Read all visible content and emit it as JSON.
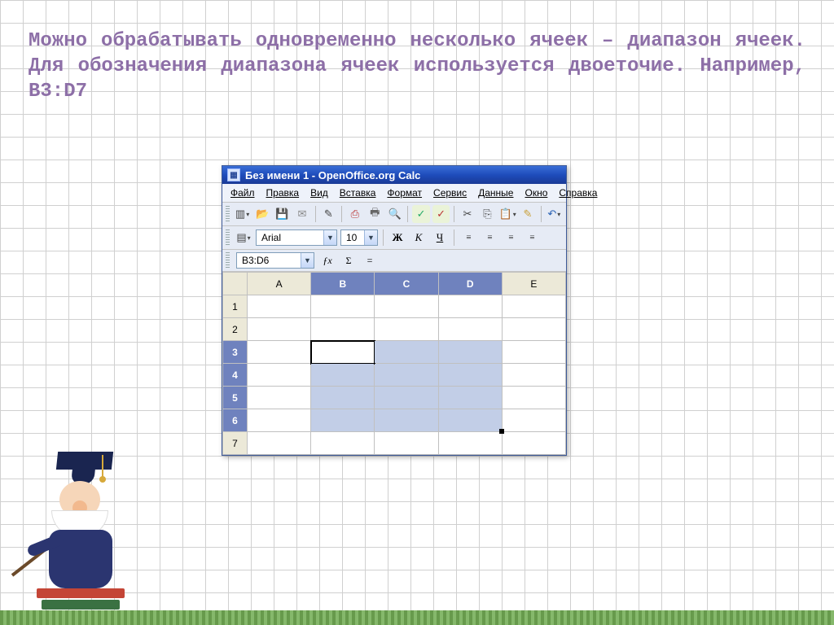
{
  "slide": {
    "text": "Можно обрабатывать одновременно несколько ячеек – диапазон ячеек. Для обозначения диапазона ячеек используется двоеточие. Например, B3:D7"
  },
  "window": {
    "title": "Без имени 1 - OpenOffice.org Calc"
  },
  "menu": {
    "file": "Файл",
    "edit": "Правка",
    "view": "Вид",
    "insert": "Вставка",
    "format": "Формат",
    "tools": "Сервис",
    "data": "Данные",
    "window": "Окно",
    "help": "Справка"
  },
  "format_bar": {
    "font": "Arial",
    "size": "10",
    "bold": "Ж",
    "italic": "К",
    "underline": "Ч"
  },
  "formula_bar": {
    "name_box": "B3:D6",
    "fx": "ƒx",
    "sigma": "Σ",
    "eq": "="
  },
  "columns": [
    "A",
    "B",
    "C",
    "D",
    "E"
  ],
  "rows": [
    "1",
    "2",
    "3",
    "4",
    "5",
    "6",
    "7"
  ]
}
